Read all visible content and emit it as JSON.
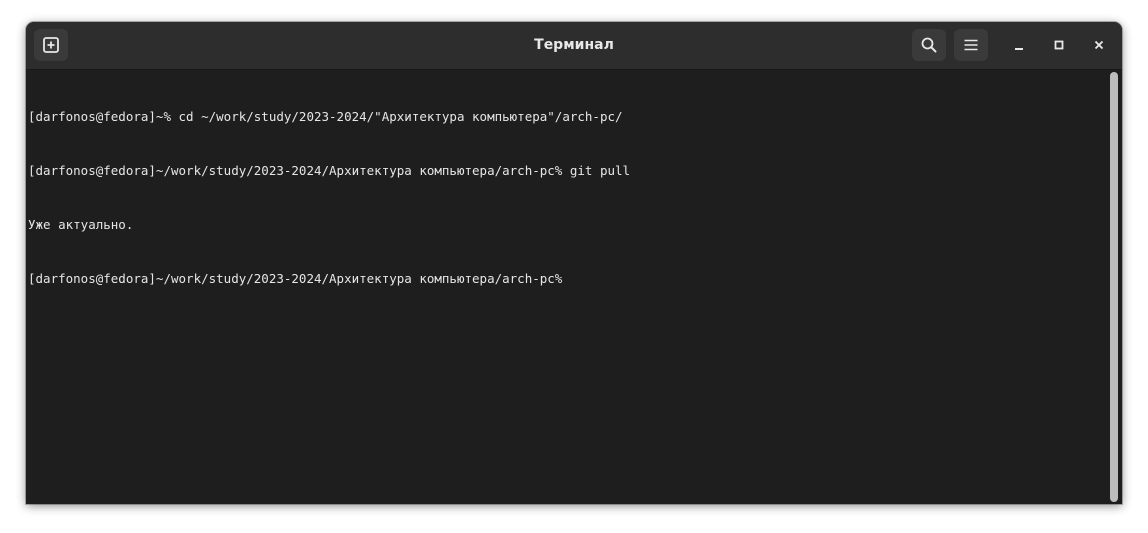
{
  "window": {
    "title": "Терминал"
  },
  "terminal": {
    "lines": [
      "[darfonos@fedora]~% cd ~/work/study/2023-2024/\"Архитектура компьютера\"/arch-pc/",
      "[darfonos@fedora]~/work/study/2023-2024/Архитектура компьютера/arch-pc% git pull",
      "Уже актуально.",
      "[darfonos@fedora]~/work/study/2023-2024/Архитектура компьютера/arch-pc%"
    ]
  },
  "icons": {
    "new_tab": "new-tab-icon",
    "search": "search-icon",
    "menu": "hamburger-menu-icon",
    "minimize": "minimize-icon",
    "maximize": "maximize-icon",
    "close": "close-icon"
  },
  "colors": {
    "terminal_bg": "#1e1e1e",
    "titlebar_bg": "#2d2d2d",
    "text": "#e6e6e6"
  }
}
